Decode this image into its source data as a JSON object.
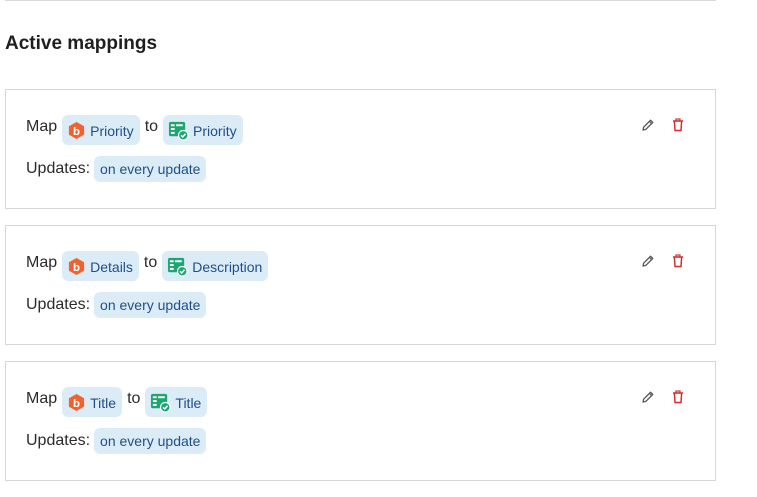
{
  "section": {
    "title": "Active mappings"
  },
  "labels": {
    "map": "Map",
    "to": "to",
    "updates": "Updates:"
  },
  "colors": {
    "chip_bg": "#dcecf7",
    "chip_text": "#1f4f86",
    "source_icon": "#f2622e",
    "target_icon": "#1ea672",
    "delete_icon": "#d0312d",
    "edit_icon": "#555555"
  },
  "mappings": [
    {
      "source": {
        "icon": "source-app-icon",
        "label": "Priority"
      },
      "target": {
        "icon": "target-app-icon",
        "label": "Priority"
      },
      "update_mode": "on every update"
    },
    {
      "source": {
        "icon": "source-app-icon",
        "label": "Details"
      },
      "target": {
        "icon": "target-app-icon",
        "label": "Description"
      },
      "update_mode": "on every update"
    },
    {
      "source": {
        "icon": "source-app-icon",
        "label": "Title"
      },
      "target": {
        "icon": "target-app-icon",
        "label": "Title"
      },
      "update_mode": "on every update"
    }
  ],
  "actions": {
    "edit_icon": "pencil-icon",
    "delete_icon": "trash-icon"
  }
}
